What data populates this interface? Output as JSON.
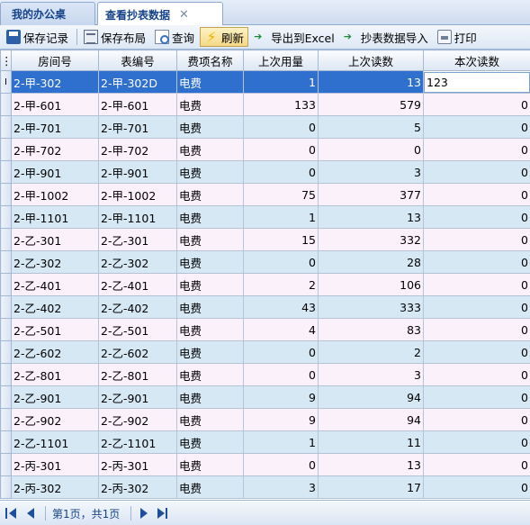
{
  "tabs": [
    {
      "label": "我的办公桌"
    },
    {
      "label": "查看抄表数据",
      "close": "✕"
    }
  ],
  "toolbar": {
    "save_record": "保存记录",
    "save_layout": "保存布局",
    "query": "查询",
    "refresh": "刷新",
    "export_excel": "导出到Excel",
    "import_meter": "抄表数据导入",
    "print": "打印"
  },
  "grid": {
    "columns": [
      "房间号",
      "表编号",
      "费项名称",
      "上次用量",
      "上次读数",
      "本次读数"
    ],
    "selected_indicator": "I",
    "edit_value": "123",
    "rows": [
      {
        "room": "2-甲-302",
        "meter": "2-甲-302D",
        "fee": "电费",
        "last_usage": "1",
        "last_reading": "13",
        "current": ""
      },
      {
        "room": "2-甲-601",
        "meter": "2-甲-601",
        "fee": "电费",
        "last_usage": "133",
        "last_reading": "579",
        "current": "0"
      },
      {
        "room": "2-甲-701",
        "meter": "2-甲-701",
        "fee": "电费",
        "last_usage": "0",
        "last_reading": "5",
        "current": "0"
      },
      {
        "room": "2-甲-702",
        "meter": "2-甲-702",
        "fee": "电费",
        "last_usage": "0",
        "last_reading": "0",
        "current": "0"
      },
      {
        "room": "2-甲-901",
        "meter": "2-甲-901",
        "fee": "电费",
        "last_usage": "0",
        "last_reading": "3",
        "current": "0"
      },
      {
        "room": "2-甲-1002",
        "meter": "2-甲-1002",
        "fee": "电费",
        "last_usage": "75",
        "last_reading": "377",
        "current": "0"
      },
      {
        "room": "2-甲-1101",
        "meter": "2-甲-1101",
        "fee": "电费",
        "last_usage": "1",
        "last_reading": "13",
        "current": "0"
      },
      {
        "room": "2-乙-301",
        "meter": "2-乙-301",
        "fee": "电费",
        "last_usage": "15",
        "last_reading": "332",
        "current": "0"
      },
      {
        "room": "2-乙-302",
        "meter": "2-乙-302",
        "fee": "电费",
        "last_usage": "0",
        "last_reading": "28",
        "current": "0"
      },
      {
        "room": "2-乙-401",
        "meter": "2-乙-401",
        "fee": "电费",
        "last_usage": "2",
        "last_reading": "106",
        "current": "0"
      },
      {
        "room": "2-乙-402",
        "meter": "2-乙-402",
        "fee": "电费",
        "last_usage": "43",
        "last_reading": "333",
        "current": "0"
      },
      {
        "room": "2-乙-501",
        "meter": "2-乙-501",
        "fee": "电费",
        "last_usage": "4",
        "last_reading": "83",
        "current": "0"
      },
      {
        "room": "2-乙-602",
        "meter": "2-乙-602",
        "fee": "电费",
        "last_usage": "0",
        "last_reading": "2",
        "current": "0"
      },
      {
        "room": "2-乙-801",
        "meter": "2-乙-801",
        "fee": "电费",
        "last_usage": "0",
        "last_reading": "3",
        "current": "0"
      },
      {
        "room": "2-乙-901",
        "meter": "2-乙-901",
        "fee": "电费",
        "last_usage": "9",
        "last_reading": "94",
        "current": "0"
      },
      {
        "room": "2-乙-902",
        "meter": "2-乙-902",
        "fee": "电费",
        "last_usage": "9",
        "last_reading": "94",
        "current": "0"
      },
      {
        "room": "2-乙-1101",
        "meter": "2-乙-1101",
        "fee": "电费",
        "last_usage": "1",
        "last_reading": "11",
        "current": "0"
      },
      {
        "room": "2-丙-301",
        "meter": "2-丙-301",
        "fee": "电费",
        "last_usage": "0",
        "last_reading": "13",
        "current": "0"
      },
      {
        "room": "2-丙-302",
        "meter": "2-丙-302",
        "fee": "电费",
        "last_usage": "3",
        "last_reading": "17",
        "current": "0"
      }
    ]
  },
  "pager": {
    "text": "第1页，共1页"
  },
  "colors": {
    "selected_row": "#2f6fce",
    "row_odd": "#fbf1fb",
    "row_even": "#d6e8f4",
    "header_text": "#15428b"
  }
}
